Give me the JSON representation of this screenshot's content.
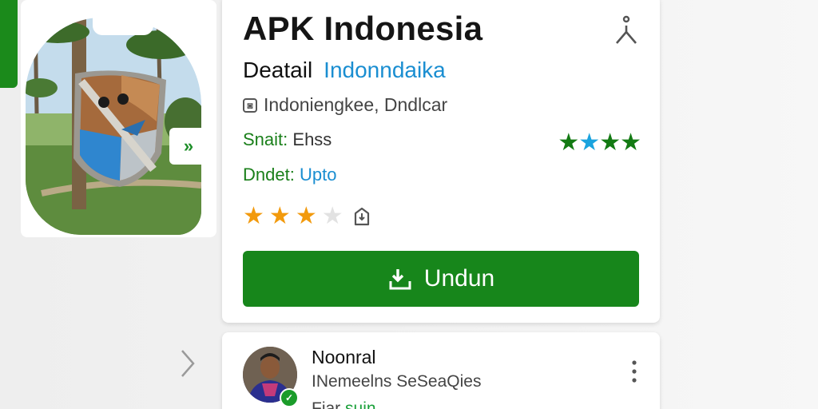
{
  "app": {
    "title": "APK Indonesia",
    "subtitle_label": "Deatail",
    "subtitle_accent": "Indonndaika",
    "developer": "Indoniengkee, Dndlcar",
    "field1_label": "Snait:",
    "field1_value": "Ehss",
    "field2_label": "Dndet:",
    "field2_value": "Upto",
    "download_label": "Undun",
    "forward_arrow": "»"
  },
  "ratings": {
    "green_stars": [
      "★",
      "★",
      "★",
      "★"
    ],
    "orange_stars_filled": 3,
    "orange_stars_total": 4
  },
  "review": {
    "author": "Noonral",
    "subtitle": "INemeelns SeSeaQies",
    "extra_prefix": "Fiar",
    "extra_green": "suin"
  },
  "icons": {
    "share": "share-icon",
    "bookmark": "bookmark-icon",
    "download": "download-icon",
    "more": "more-vertical-icon",
    "chevron": "chevron-right-icon",
    "verified": "verified-badge-icon",
    "developer": "developer-icon"
  },
  "colors": {
    "brand_green": "#17861b",
    "accent_blue": "#1a8ed1",
    "star_orange": "#f29a0d"
  }
}
